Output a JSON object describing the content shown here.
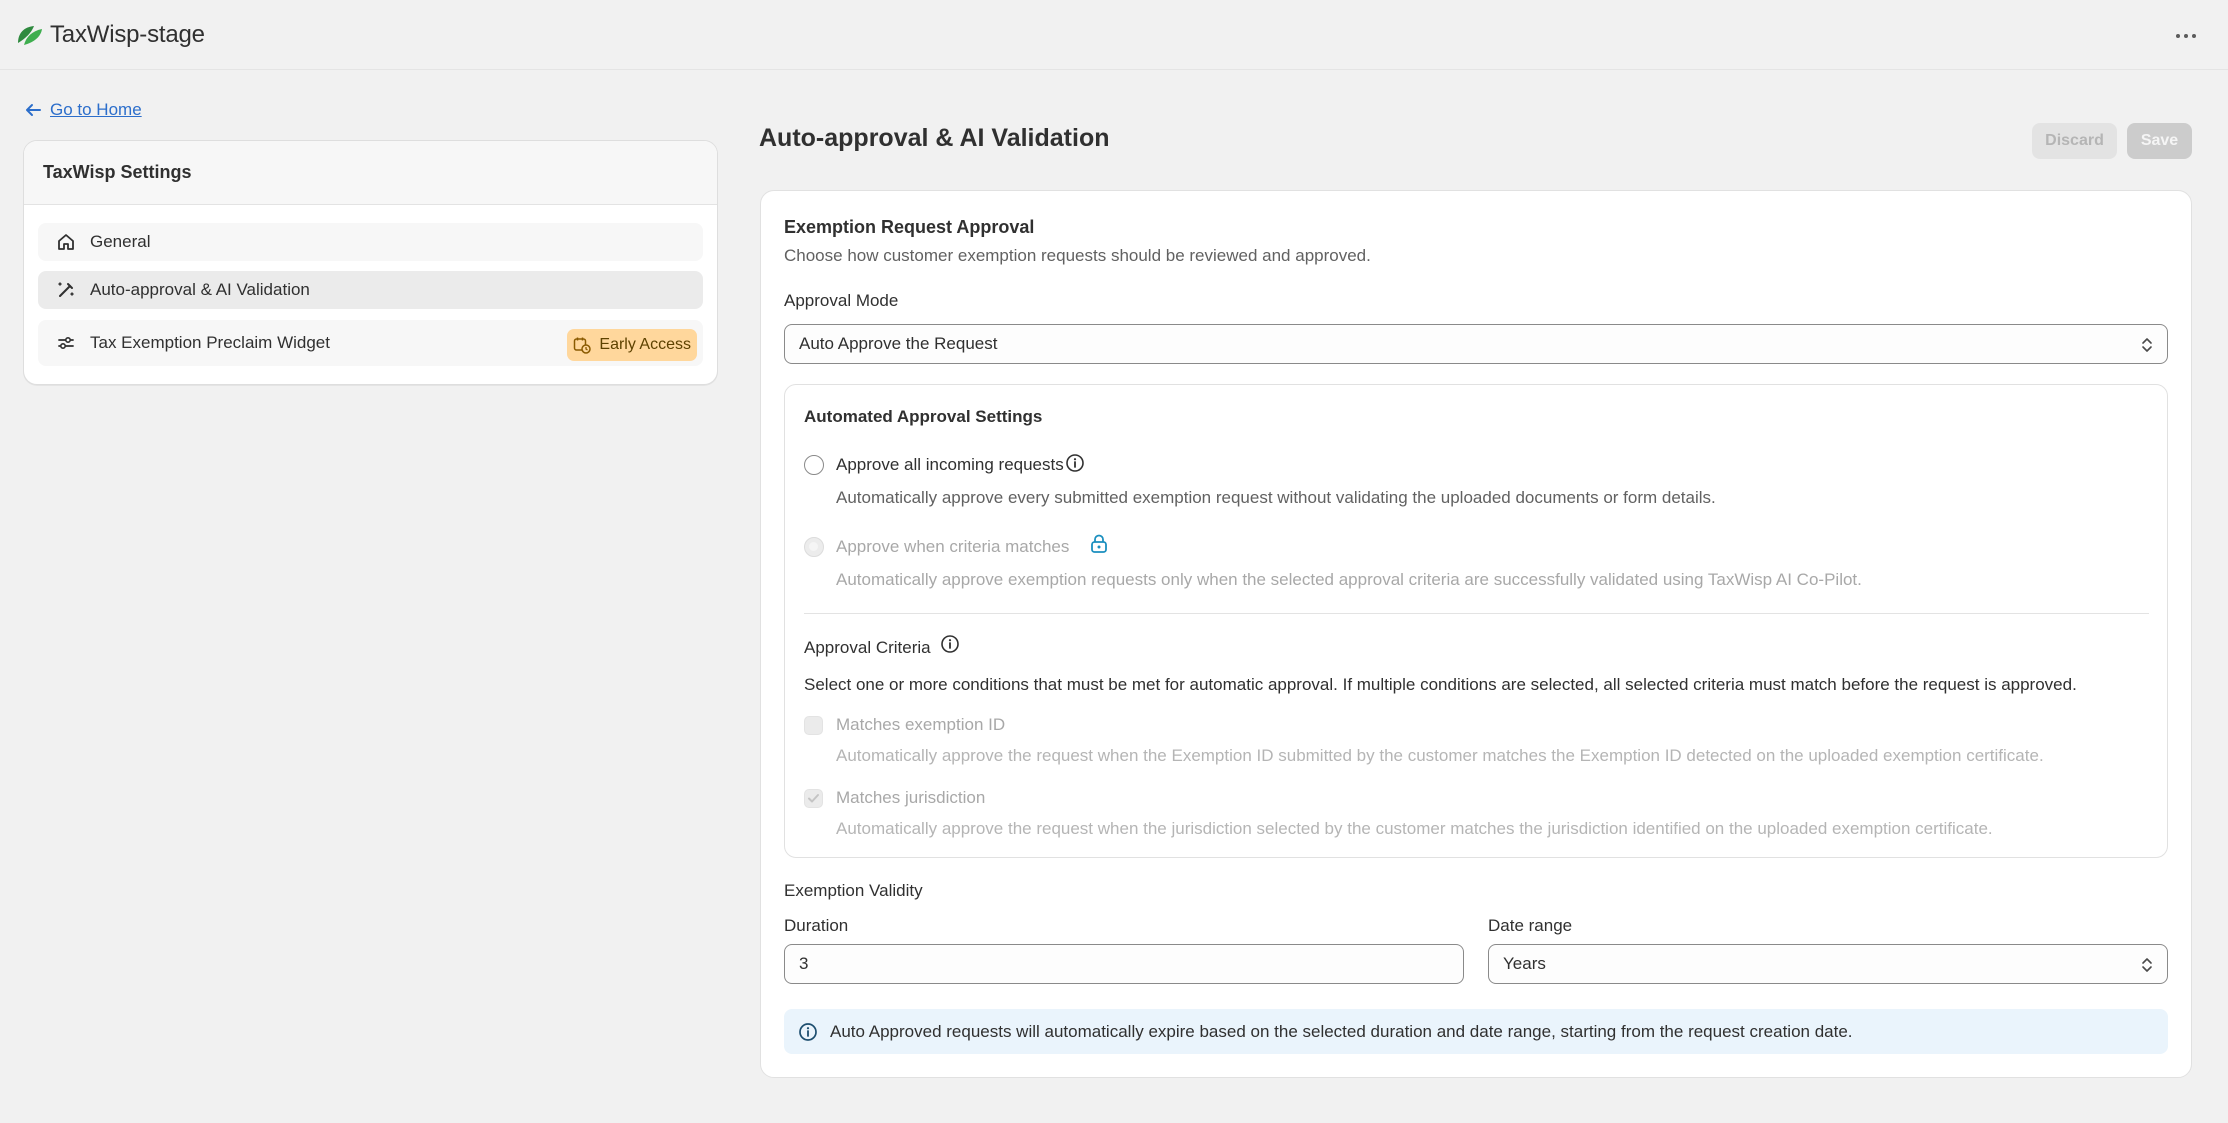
{
  "app": {
    "title": "TaxWisp-stage",
    "logo_icon": "leaf-logo-icon",
    "accent": "#2f8a3f"
  },
  "nav": {
    "back_label": "Go to Home"
  },
  "sidebar": {
    "title": "TaxWisp Settings",
    "items": [
      {
        "label": "General",
        "icon": "home-icon"
      },
      {
        "label": "Auto-approval & AI Validation",
        "icon": "magic-wand-icon",
        "selected": true
      },
      {
        "label": "Tax Exemption Preclaim Widget",
        "icon": "sliders-icon",
        "badge": "Early Access",
        "badge_icon": "calendar-clock-icon"
      }
    ]
  },
  "page": {
    "title": "Auto-approval & AI Validation",
    "discard_label": "Discard",
    "save_label": "Save"
  },
  "approval": {
    "title": "Exemption Request Approval",
    "subtitle": "Choose how customer exemption requests should be reviewed and approved.",
    "mode_label": "Approval Mode",
    "mode_value": "Auto Approve the Request"
  },
  "automated": {
    "title": "Automated Approval Settings",
    "option_all": {
      "label": "Approve all incoming requests",
      "help": "Automatically approve every submitted exemption request without validating the uploaded documents or form details."
    },
    "option_criteria": {
      "label": "Approve when criteria matches",
      "help": "Automatically approve exemption requests only when the selected approval criteria are successfully validated using TaxWisp AI Co-Pilot."
    }
  },
  "criteria": {
    "title": "Approval Criteria",
    "description": "Select one or more conditions that must be met for automatic approval. If multiple conditions are selected, all selected criteria must match before the request is approved.",
    "items": [
      {
        "label": "Matches exemption ID",
        "help": "Automatically approve the request when the Exemption ID submitted by the customer matches the Exemption ID detected on the uploaded exemption certificate.",
        "checked": false
      },
      {
        "label": "Matches jurisdiction",
        "help": "Automatically approve the request when the jurisdiction selected by the customer matches the jurisdiction identified on the uploaded exemption certificate.",
        "checked": true
      }
    ]
  },
  "validity": {
    "title": "Exemption Validity",
    "duration_label": "Duration",
    "duration_value": "3",
    "range_label": "Date range",
    "range_value": "Years",
    "info": "Auto Approved requests will automatically expire based on the selected duration and date range, starting from the request creation date."
  },
  "colors": {
    "badge_bg": "#ffd79c",
    "link": "#2c6ecb",
    "info_bg": "#eaf4fc",
    "lock_icon": "#1b8fbf"
  }
}
